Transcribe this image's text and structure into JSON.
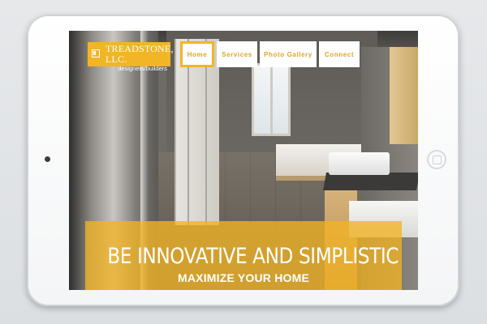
{
  "logo": {
    "name": "TREADSTONE, LLC.",
    "tagline": "designers/builders"
  },
  "nav": {
    "items": [
      {
        "label": "Home",
        "active": true
      },
      {
        "label": "Services",
        "active": false
      },
      {
        "label": "Photo Gallery",
        "active": false
      },
      {
        "label": "Connect",
        "active": false
      }
    ]
  },
  "hero": {
    "title": "BE INNOVATIVE AND SIMPLISTIC",
    "subtitle": "MAXIMIZE YOUR HOME"
  },
  "colors": {
    "accent": "#f1b526",
    "device": "#ffffff",
    "background": "#e3e5e7"
  }
}
